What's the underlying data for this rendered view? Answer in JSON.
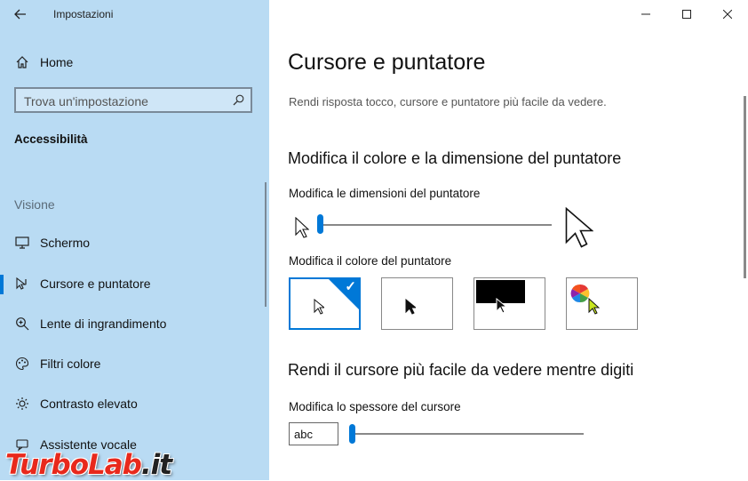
{
  "window": {
    "app_title": "Impostazioni",
    "controls": [
      "minimize-icon",
      "maximize-icon",
      "close-icon"
    ]
  },
  "sidebar": {
    "home_label": "Home",
    "search_placeholder": "Trova un'impostazione",
    "section_title": "Accessibilità",
    "group_title": "Visione",
    "items": [
      {
        "label": "Schermo",
        "icon": "monitor-icon"
      },
      {
        "label": "Cursore e puntatore",
        "icon": "cursor-pointer-icon",
        "selected": true
      },
      {
        "label": "Lente di ingrandimento",
        "icon": "magnifier-icon"
      },
      {
        "label": "Filtri colore",
        "icon": "palette-icon"
      },
      {
        "label": "Contrasto elevato",
        "icon": "brightness-icon"
      },
      {
        "label": "Assistente vocale",
        "icon": "narrator-icon"
      }
    ]
  },
  "main": {
    "title": "Cursore e puntatore",
    "description": "Rendi risposta tocco, cursore e puntatore più facile da vedere.",
    "pointer_section": {
      "heading": "Modifica il colore e la dimensione del puntatore",
      "size_label": "Modifica le dimensioni del puntatore",
      "size_value_fraction": 0.0,
      "color_label": "Modifica il colore del puntatore",
      "color_options": [
        {
          "name": "white",
          "selected": true
        },
        {
          "name": "black",
          "selected": false
        },
        {
          "name": "inverted",
          "selected": false
        },
        {
          "name": "custom",
          "selected": false
        }
      ]
    },
    "cursor_section": {
      "heading": "Rendi il cursore più facile da vedere mentre digiti",
      "thickness_label": "Modifica lo spessore del cursore",
      "preview_text": "abc",
      "thickness_value_fraction": 0.0
    }
  },
  "watermark": {
    "brand": "TurboLab",
    "suffix": ".it"
  },
  "colors": {
    "sidebar_bg": "#b9dbf3",
    "accent": "#0078d7",
    "custom_pointer": "#c8e61e"
  }
}
